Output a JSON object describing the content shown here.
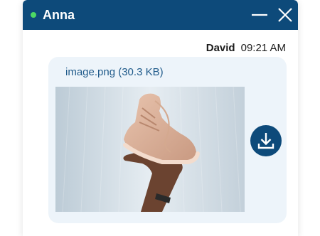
{
  "chat": {
    "contact_name": "Anna",
    "status_color": "#4cd964",
    "header_color": "#0d4a7a",
    "controls": {
      "minimize_icon": "minimize-icon",
      "close_icon": "close-icon"
    }
  },
  "message": {
    "sender": "David",
    "time": "09:21 AM",
    "attachment": {
      "file_name": "image.png (30.3 KB)",
      "image_subject": "photo",
      "download_icon": "download-icon"
    }
  }
}
